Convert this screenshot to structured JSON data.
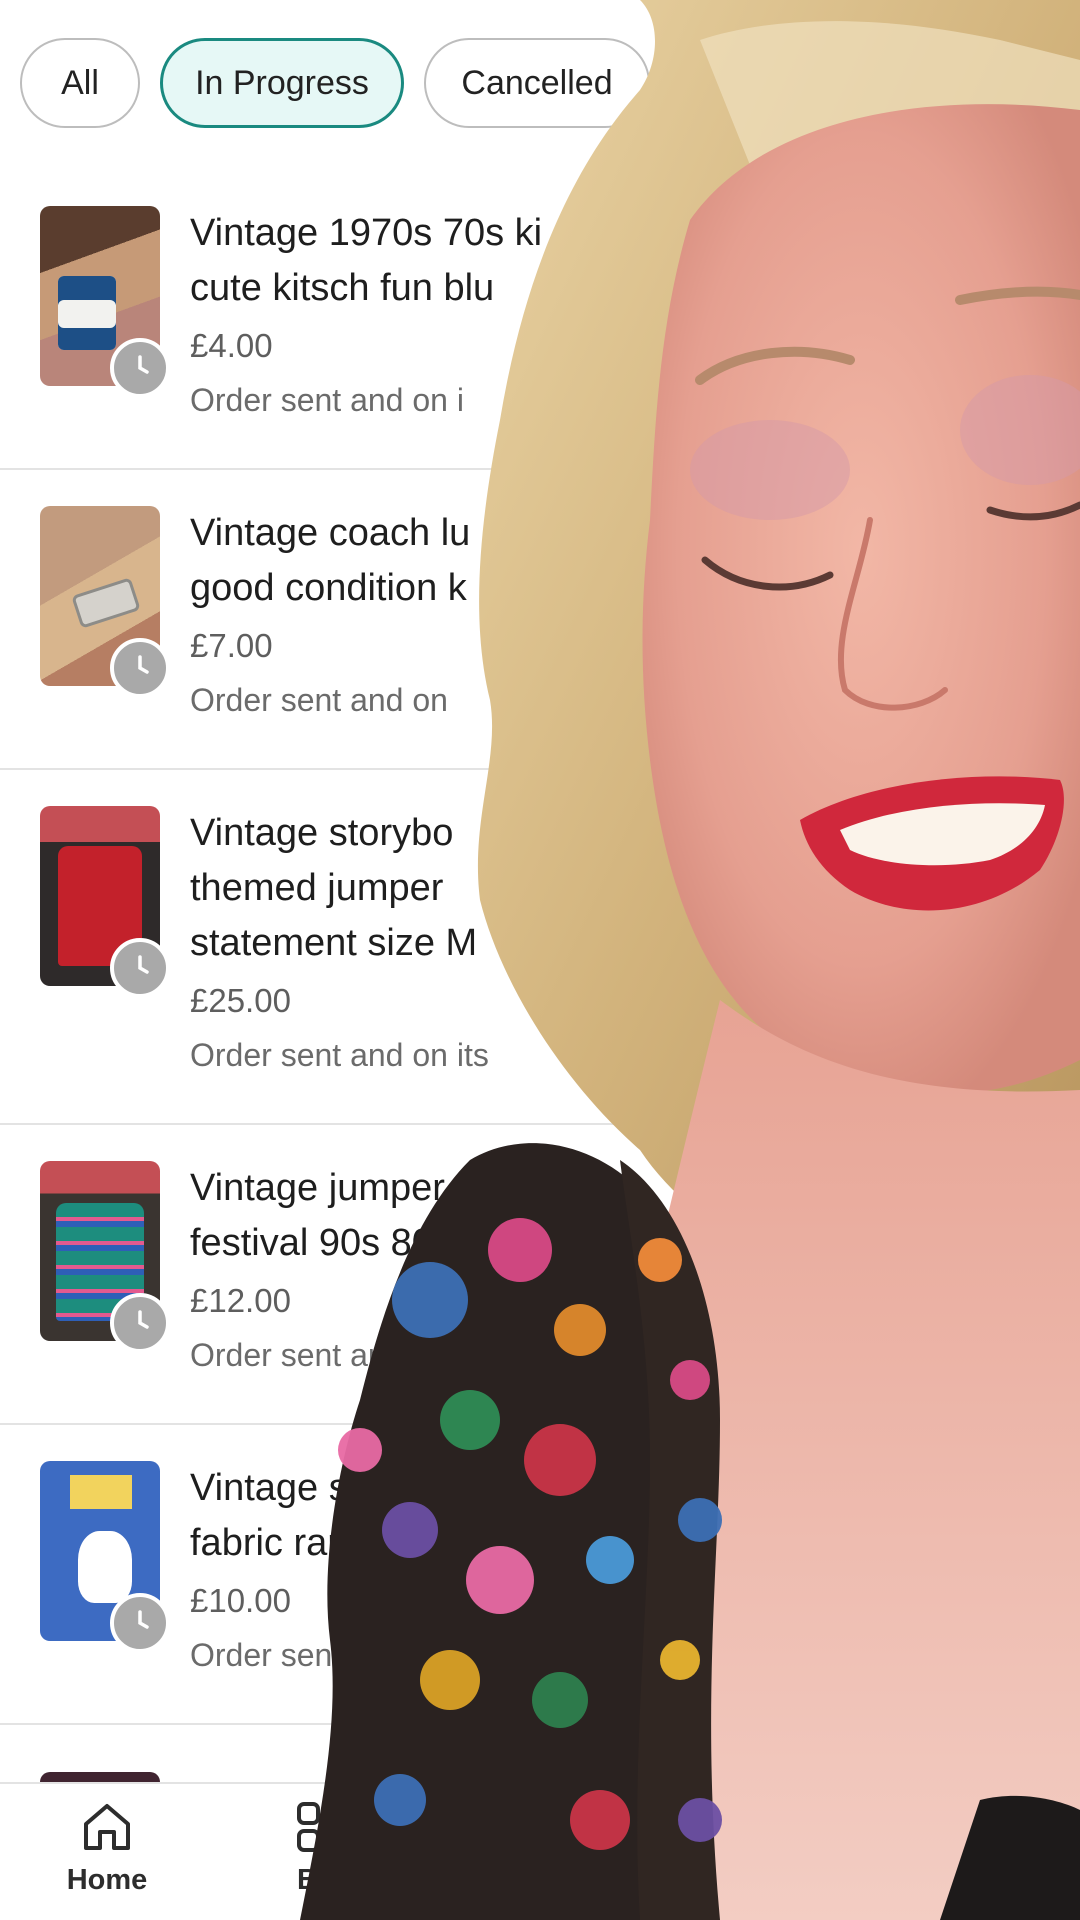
{
  "filters": {
    "chips": [
      {
        "label": "All",
        "active": false
      },
      {
        "label": "In Progress",
        "active": true
      },
      {
        "label": "Cancelled",
        "active": false
      }
    ]
  },
  "orders": [
    {
      "title": "Vintage 1970s 70s ki\ncute kitsch fun blu",
      "price": "£4.00",
      "status": "Order sent and on i"
    },
    {
      "title": "Vintage coach lu\ngood condition k",
      "price": "£7.00",
      "status": "Order sent and on"
    },
    {
      "title": "Vintage storybo\nthemed jumper\nstatement size M",
      "price": "£25.00",
      "status": "Order sent and on its"
    },
    {
      "title": "Vintage jumper s\nfestival 90s 80",
      "price": "£12.00",
      "status": "Order sent and"
    },
    {
      "title": "Vintage s\nfabric ran",
      "price": "£10.00",
      "status": "Order sent"
    }
  ],
  "nav": {
    "home": "Home",
    "browse": "Bro"
  },
  "colors": {
    "active_chip_border": "#1a8a80",
    "active_chip_bg": "#e6f8f6",
    "status_clock": "#a9a9a9"
  }
}
